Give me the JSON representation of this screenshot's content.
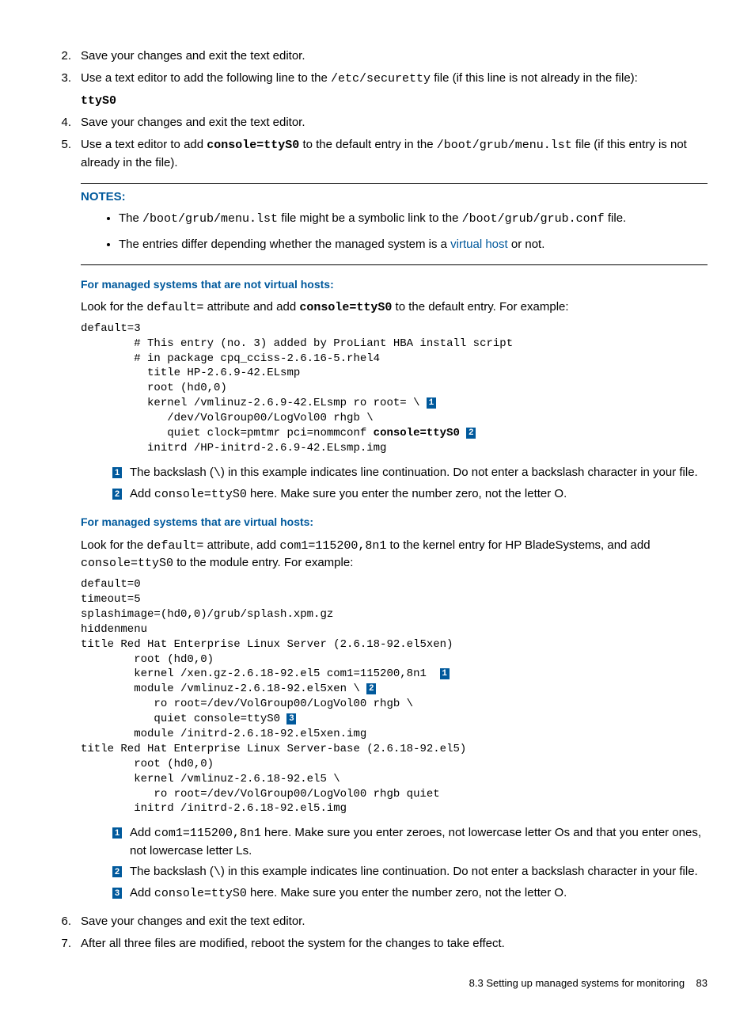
{
  "steps": {
    "2": {
      "num": "2.",
      "text": "Save your changes and exit the text editor."
    },
    "3": {
      "num": "3.",
      "pre": "Use a text editor to add the following line to the ",
      "path": "/etc/securetty",
      "post": " file (if this line is not already in the file):",
      "code": "ttyS0"
    },
    "4": {
      "num": "4.",
      "text": "Save your changes and exit the text editor."
    },
    "5": {
      "num": "5.",
      "pre": "Use a text editor to add ",
      "consolecode": "console=ttyS0",
      "mid": " to the default entry in the ",
      "path": "/boot/grub/menu.lst",
      "post": " file (if this entry is not already in the file)."
    },
    "6": {
      "num": "6.",
      "text": "Save your changes and exit the text editor."
    },
    "7": {
      "num": "7.",
      "text": "After all three files are modified, reboot the system for the changes to take effect."
    }
  },
  "notes": {
    "title": "NOTES:",
    "b1_pre": "The ",
    "b1_path1": "/boot/grub/menu.lst",
    "b1_mid": " file might be a symbolic link to the ",
    "b1_path2": "/boot/grub/grub.conf",
    "b1_post": " file.",
    "b2_pre": "The entries differ depending whether the managed system is a ",
    "b2_link": "virtual host",
    "b2_post": " or not."
  },
  "sec1": {
    "head": "For managed systems that are not virtual hosts:",
    "intro_pre": "Look for the ",
    "intro_attr": "default=",
    "intro_mid": " attribute and add ",
    "intro_code": "console=ttyS0",
    "intro_post": " to the default entry. For example:"
  },
  "code1": {
    "l1": "default=3",
    "l2": "        # This entry (no. 3) added by ProLiant HBA install script",
    "l3": "        # in package cpq_cciss-2.6.16-5.rhel4",
    "l4": "          title HP-2.6.9-42.ELsmp",
    "l5": "          root (hd0,0)",
    "l6a": "          kernel /vmlinuz-2.6.9-42.ELsmp ro root= \\ ",
    "l7": "             /dev/VolGroup00/LogVol00 rhgb \\",
    "l8a": "             quiet clock=pmtmr pci=nommconf ",
    "l8b": "console=ttyS0",
    "l8c": " ",
    "l9": "          initrd /HP-initrd-2.6.9-42.ELsmp.img"
  },
  "call1": {
    "c1": {
      "n": "1",
      "pre": "The backslash (",
      "sl": "\\",
      "post": ") in this example indicates line continuation. Do not enter a backslash character in your file."
    },
    "c2": {
      "n": "2",
      "pre": "Add ",
      "code": "console=ttyS0",
      "post": " here. Make sure you enter the number zero, not the letter O."
    }
  },
  "sec2": {
    "head": "For managed systems that are virtual hosts:",
    "intro_pre": "Look for the ",
    "intro_attr": "default=",
    "intro_mid1": " attribute, add ",
    "intro_com": "com1=115200,8n1",
    "intro_mid2": " to the kernel entry for HP BladeSystems, and add ",
    "intro_console": "console=ttyS0",
    "intro_post": " to the module entry. For example:"
  },
  "code2": {
    "l1": "default=0",
    "l2": "timeout=5",
    "l3": "splashimage=(hd0,0)/grub/splash.xpm.gz",
    "l4": "hiddenmenu",
    "l5": "title Red Hat Enterprise Linux Server (2.6.18-92.el5xen)",
    "l6": "        root (hd0,0)",
    "l7a": "        kernel /xen.gz-2.6.18-92.el5 com1=115200,8n1  ",
    "l8a": "        module /vmlinuz-2.6.18-92.el5xen \\ ",
    "l9": "           ro root=/dev/VolGroup00/LogVol00 rhgb \\",
    "l10a": "           quiet console=ttyS0 ",
    "l11": "        module /initrd-2.6.18-92.el5xen.img",
    "l12": "title Red Hat Enterprise Linux Server-base (2.6.18-92.el5)",
    "l13": "        root (hd0,0)",
    "l14": "        kernel /vmlinuz-2.6.18-92.el5 \\",
    "l15": "           ro root=/dev/VolGroup00/LogVol00 rhgb quiet",
    "l16": "        initrd /initrd-2.6.18-92.el5.img"
  },
  "call2": {
    "c1": {
      "n": "1",
      "pre": "Add ",
      "code": "com1=115200,8n1",
      "post": " here. Make sure you enter zeroes, not lowercase letter Os and that you enter ones, not lowercase letter Ls."
    },
    "c2": {
      "n": "2",
      "pre": "The backslash (",
      "sl": "\\",
      "post": ") in this example indicates line continuation. Do not enter a backslash character in your file."
    },
    "c3": {
      "n": "3",
      "pre": "Add ",
      "code": "console=ttyS0",
      "post": " here. Make sure you enter the number zero, not the letter O."
    }
  },
  "footer": {
    "section": "8.3 Setting up managed systems for monitoring",
    "page": "83"
  }
}
